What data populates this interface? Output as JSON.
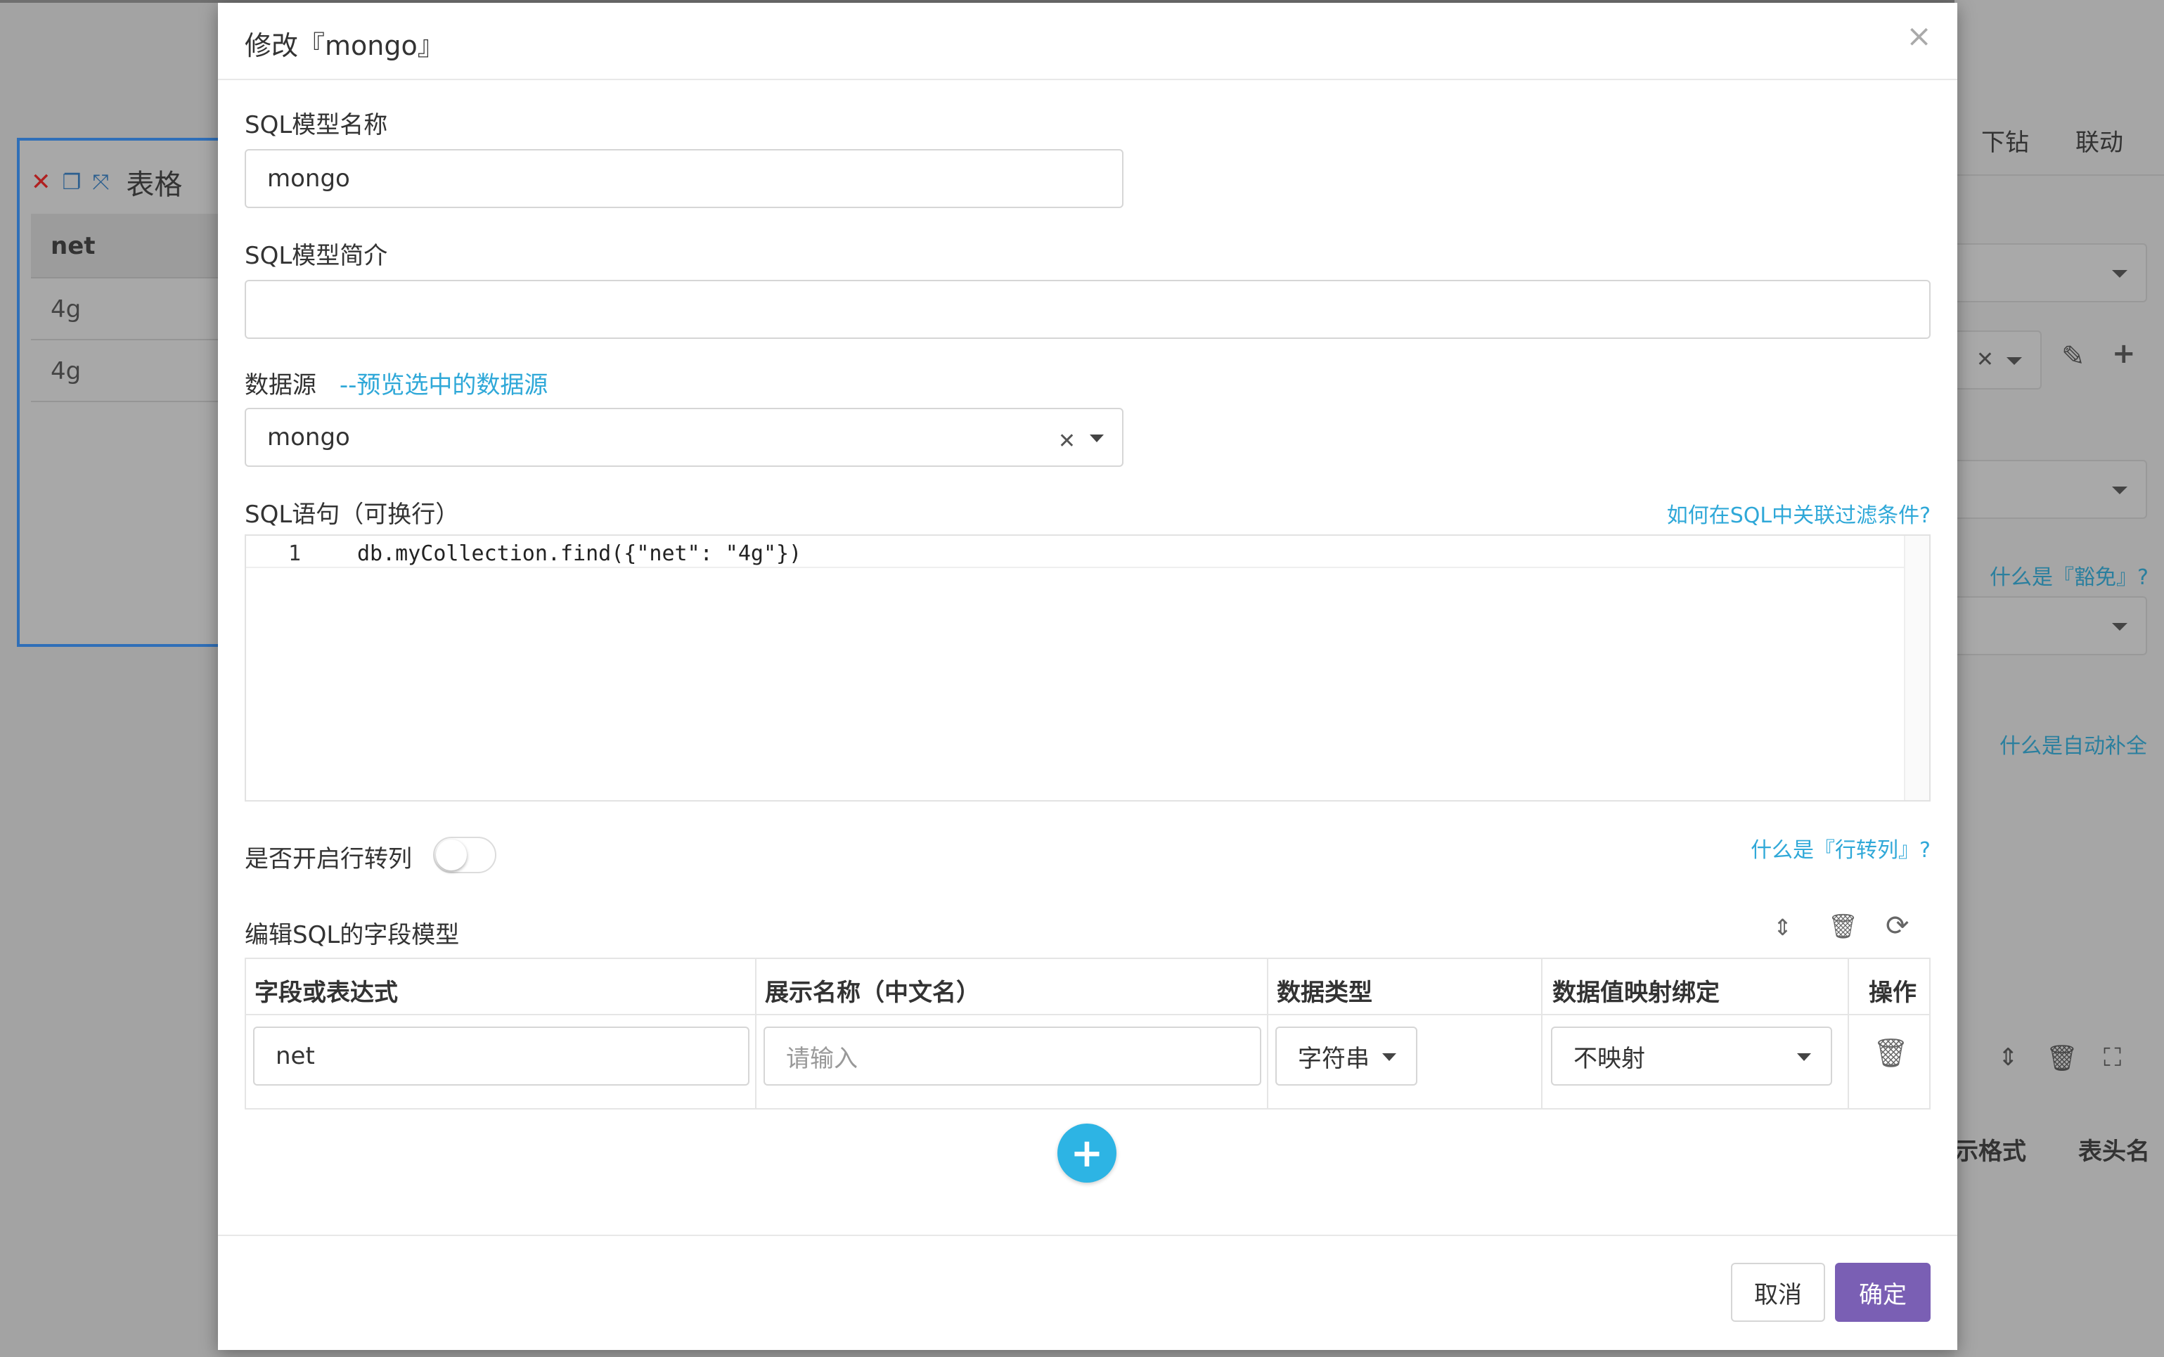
{
  "background": {
    "widget": {
      "title": "表格",
      "column": "net",
      "rows": [
        "4g",
        "4g"
      ]
    },
    "panel": {
      "tabs": [
        "下钻",
        "联动"
      ],
      "links": [
        "什么是『豁免』?",
        "什么是自动补全"
      ],
      "table_headers": [
        "示格式",
        "表头名"
      ]
    }
  },
  "modal": {
    "title": "修改『mongo』",
    "model_name": {
      "label": "SQL模型名称",
      "value": "mongo"
    },
    "model_desc": {
      "label": "SQL模型简介",
      "value": ""
    },
    "datasource": {
      "label": "数据源",
      "preview_link": "--预览选中的数据源",
      "value": "mongo"
    },
    "sql": {
      "label": "SQL语句（可换行）",
      "help_link": "如何在SQL中关联过滤条件?",
      "line_number": "1",
      "code": "db.myCollection.find({\"net\": \"4g\"})"
    },
    "pivot": {
      "label": "是否开启行转列",
      "help_link": "什么是『行转列』?",
      "enabled": false
    },
    "field_model": {
      "label": "编辑SQL的字段模型",
      "headers": [
        "字段或表达式",
        "展示名称（中文名）",
        "数据类型",
        "数据值映射绑定",
        "操作"
      ],
      "rows": [
        {
          "field": "net",
          "display_placeholder": "请输入",
          "type": "字符串",
          "mapping": "不映射"
        }
      ]
    },
    "footer": {
      "cancel": "取消",
      "ok": "确定"
    }
  },
  "colors": {
    "accent": "#2fa8d8",
    "primary": "#7a5fb4",
    "add_button": "#2db4e4"
  }
}
